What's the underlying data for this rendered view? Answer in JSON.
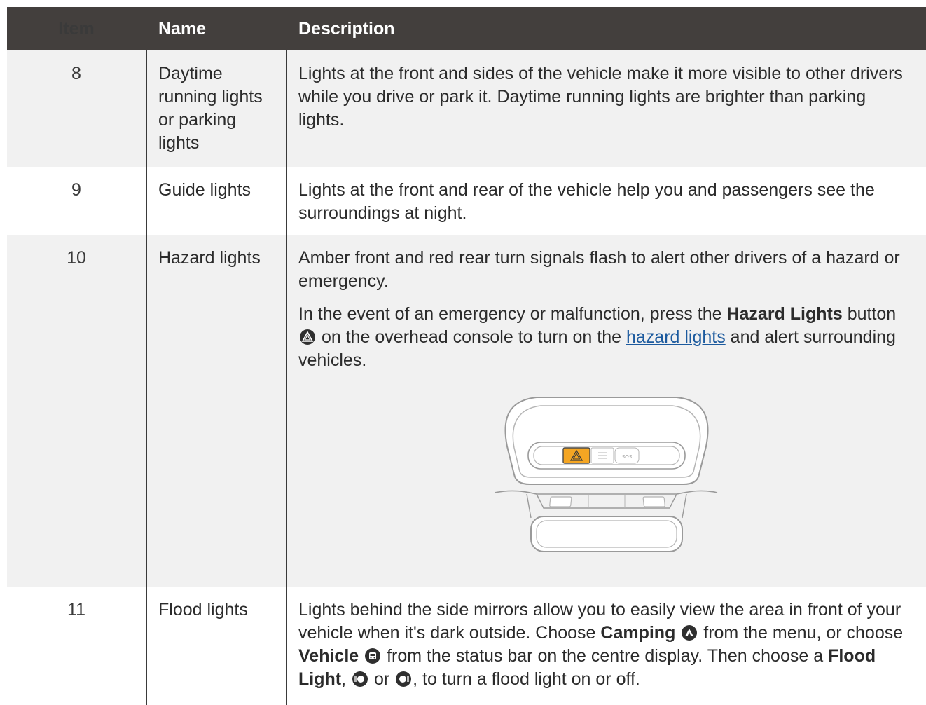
{
  "header": {
    "item": "Item",
    "name": "Name",
    "description": "Description"
  },
  "rows": [
    {
      "item": "8",
      "name": "Daytime running lights or parking lights",
      "description": "Lights at the front and sides of the vehicle make it more visible to other drivers while you drive or park it. Daytime running lights are brighter than parking lights."
    },
    {
      "item": "9",
      "name": "Guide lights",
      "description": "Lights at the front and rear of the vehicle help you and passengers see the surroundings at night."
    },
    {
      "item": "10",
      "name": "Hazard lights",
      "description": "Amber front and red rear turn signals flash to alert other drivers of a hazard or emergency.",
      "p2": {
        "pre": "In the event of an emergency or malfunction, press the ",
        "bold": "Hazard Lights",
        "post_button": " button ",
        "mid": " on the overhead console to turn on the ",
        "link": "hazard lights",
        "end": " and alert surrounding vehicles."
      },
      "illustration": {
        "sos_label": "SOS",
        "highlight_color": "#f5a623"
      }
    },
    {
      "item": "11",
      "name": "Flood lights",
      "p": {
        "t1": "Lights behind the side mirrors allow you to easily view the area in front of your vehicle when it's dark outside. Choose ",
        "b1": "Camping",
        "t2": " from the menu, or choose ",
        "b2": "Vehicle",
        "t3": " from the status bar on the centre display. Then choose a ",
        "b3": "Flood Light",
        "t4": ", ",
        "t5": " or ",
        "t6": ", to turn a flood light on or off."
      }
    }
  ],
  "icons": {
    "hazard": "hazard-triangle-icon",
    "camping": "camping-tent-icon",
    "vehicle": "vehicle-icon",
    "flood_left": "flood-light-left-icon",
    "flood_right": "flood-light-right-icon"
  }
}
